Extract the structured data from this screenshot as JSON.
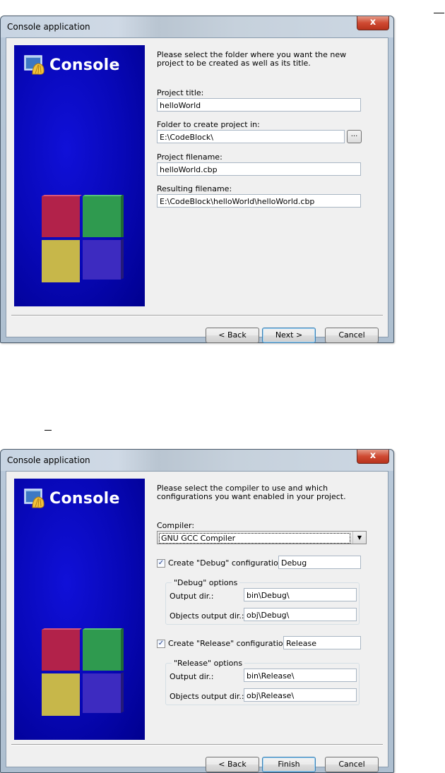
{
  "dialog1": {
    "title": "Console application",
    "close_label": "x",
    "banner_text": "Console",
    "intro": "Please select the folder where you want the new project to be created as well as its title.",
    "fields": [
      {
        "label": "Project title:",
        "value": "helloWorld"
      },
      {
        "label": "Folder to create project in:",
        "value": "E:\\CodeBlock\\"
      },
      {
        "label": "Project filename:",
        "value": "helloWorld.cbp"
      },
      {
        "label": "Resulting filename:",
        "value": "E:\\CodeBlock\\helloWorld\\helloWorld.cbp"
      }
    ],
    "browse_label": "...",
    "buttons": {
      "back": "< Back",
      "next": "Next >",
      "cancel": "Cancel"
    }
  },
  "dialog2": {
    "title": "Console application",
    "close_label": "x",
    "banner_text": "Console",
    "intro": "Please select the compiler to use and which configurations you want enabled in your project.",
    "compiler_label": "Compiler:",
    "compiler_value": "GNU GCC Compiler",
    "debug": {
      "checkbox_label": "Create \"Debug\" configuration:",
      "name_value": "Debug",
      "group_title": "\"Debug\" options",
      "output_label": "Output dir.:",
      "output_value": "bin\\Debug\\",
      "objects_label": "Objects output dir.:",
      "objects_value": "obj\\Debug\\"
    },
    "release": {
      "checkbox_label": "Create \"Release\" configuration:",
      "name_value": "Release",
      "group_title": "\"Release\" options",
      "output_label": "Output dir.:",
      "output_value": "bin\\Release\\",
      "objects_label": "Objects output dir.:",
      "objects_value": "obj\\Release\\"
    },
    "buttons": {
      "back": "< Back",
      "finish": "Finish",
      "cancel": "Cancel"
    }
  },
  "colors": {
    "banner": "#0808b8",
    "default_button_border": "#3c7fb1"
  }
}
